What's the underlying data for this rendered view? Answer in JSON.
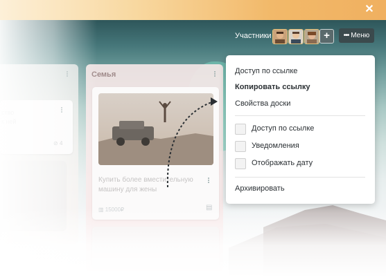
{
  "header": {
    "close_icon": "close-icon"
  },
  "board": {
    "members_label": "Участники",
    "add_label": "+",
    "menu_label": "Меню",
    "menu_dots": "•••"
  },
  "lists": {
    "left": {
      "card_text": [
        "ство",
        "к ней"
      ],
      "badge": "4"
    },
    "family": {
      "title": "Семья",
      "card_text": "Купить более вместительную машину для жены",
      "card_price": "15000₽"
    }
  },
  "dropdown": {
    "items": [
      "Доступ по ссылке",
      "Копировать ссылку",
      "Свойства доски"
    ],
    "checks": [
      {
        "label": "Доступ по ссылке",
        "checked": false
      },
      {
        "label": "Уведомления",
        "checked": false
      },
      {
        "label": "Отображать дату",
        "checked": false
      }
    ],
    "archive": "Архивировать"
  },
  "colors": {
    "accent": "#f0b060",
    "menu_bg": "#3b4a4d",
    "teal_blob": "#78d2be"
  }
}
